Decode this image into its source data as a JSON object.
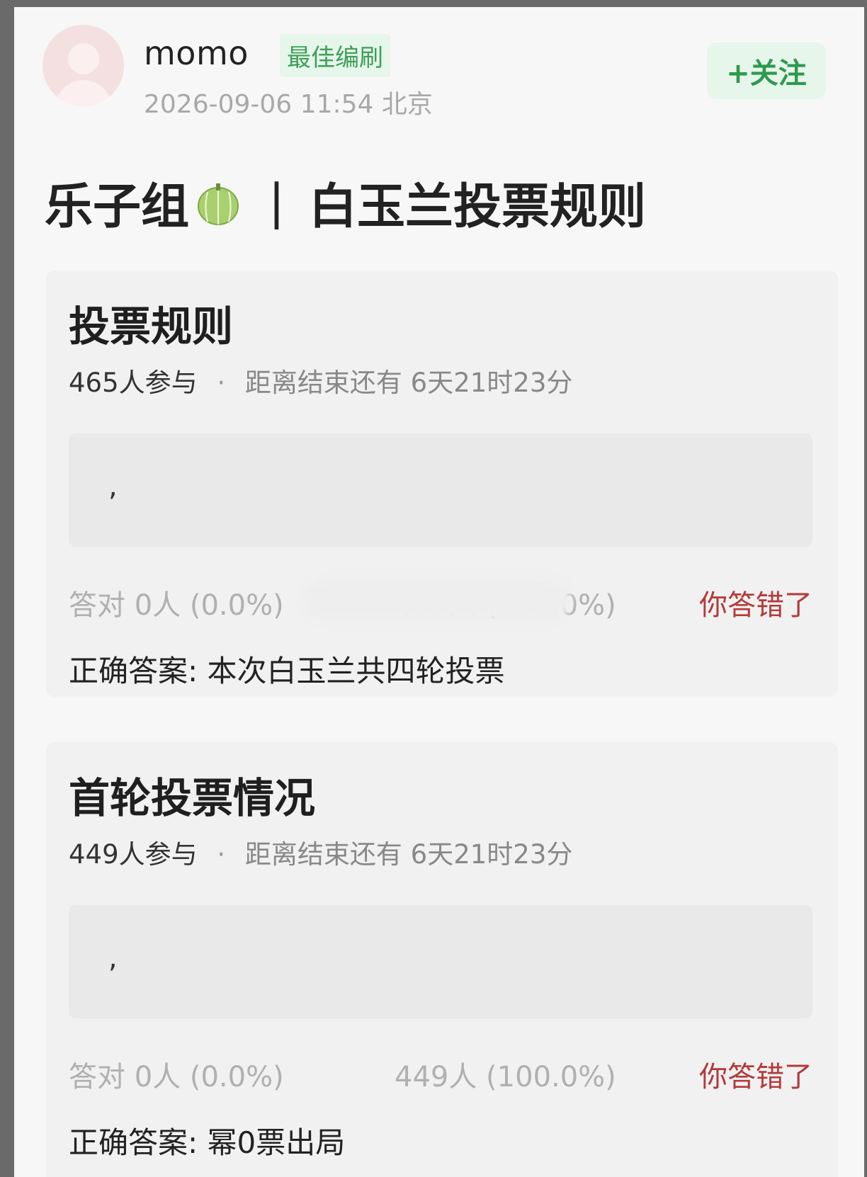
{
  "header": {
    "username": "momo",
    "badge": "最佳编刷",
    "meta": "2026-09-06 11:54 北京",
    "follow_label": "+关注"
  },
  "post": {
    "title_left": "乐子组",
    "title_separator": "|",
    "title_right": "白玉兰投票规则",
    "emoji_icon": "melon-icon"
  },
  "polls": [
    {
      "title": "投票规则",
      "participants": "465人参与",
      "remaining": "距离结束还有 6天21时23分",
      "option_text": ",",
      "correct": "答对 0人 (0.0%)",
      "wrong": "465人 (100.0%)",
      "verdict": "你答错了",
      "answer": "正确答案: 本次白玉兰共四轮投票"
    },
    {
      "title": "首轮投票情况",
      "participants": "449人参与",
      "remaining": "距离结束还有 6天21时23分",
      "option_text": ",",
      "correct": "答对 0人 (0.0%)",
      "wrong": "449人 (100.0%)",
      "verdict": "你答错了",
      "answer": "正确答案: 幂0票出局"
    }
  ],
  "colors": {
    "accent_green": "#2f9a4e",
    "verdict_red": "#b23a3a",
    "card_bg": "#f1f1f1"
  }
}
